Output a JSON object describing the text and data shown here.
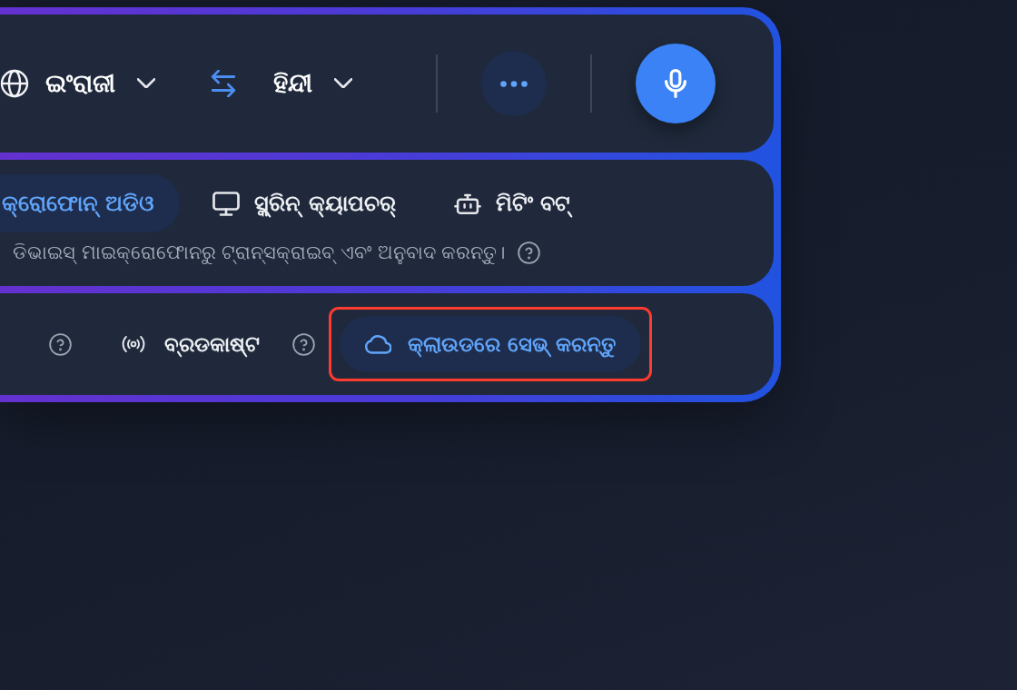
{
  "language_bar": {
    "source_language": "ଇଂରାଜୀ",
    "target_language": "ହିନ୍ଦୀ"
  },
  "input_source": {
    "tabs": [
      {
        "label": "କ୍ରୋଫୋନ୍ ଅଡିଓ",
        "selected": true
      },
      {
        "label": "ସ୍କ୍ରିନ୍ କ୍ୟାପଚର୍",
        "selected": false
      },
      {
        "label": "ମିଟିଂ ବଟ୍",
        "selected": false
      }
    ],
    "description": "ଡିଭାଇସ୍ ମାଇକ୍ରୋଫୋନରୁ ଟ୍ରାନ୍ସକ୍ରାଇବ୍ ଏବଂ ଅନୁବାଦ କରନ୍ତୁ।"
  },
  "output_options": [
    {
      "kind": "help"
    },
    {
      "kind": "option",
      "label": "ବ୍ରଡକାଷ୍ଟ"
    },
    {
      "kind": "help"
    },
    {
      "kind": "button",
      "label": "କ୍ଲାଉଡରେ ସେଭ୍ କରନ୍ତୁ",
      "highlighted": true
    }
  ]
}
